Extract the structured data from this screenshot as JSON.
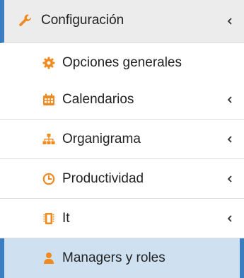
{
  "menu": {
    "header": {
      "label": "Configuración",
      "icon": "wrench-icon"
    },
    "items": [
      {
        "label": "Opciones generales",
        "icon": "gear-icon",
        "has_submenu": false
      },
      {
        "label": "Calendarios",
        "icon": "calendar-icon",
        "has_submenu": true
      },
      {
        "label": "Organigrama",
        "icon": "sitemap-icon",
        "has_submenu": true
      },
      {
        "label": "Productividad",
        "icon": "clock-icon",
        "has_submenu": true
      },
      {
        "label": "It",
        "icon": "chip-icon",
        "has_submenu": true
      },
      {
        "label": "Managers y roles",
        "icon": "user-icon",
        "has_submenu": false,
        "active": true
      }
    ]
  },
  "colors": {
    "accent": "#3a7dc0",
    "icon": "#f08a1e",
    "header_bg": "#ececec",
    "active_bg": "#cfe1f1",
    "text": "#222222"
  }
}
